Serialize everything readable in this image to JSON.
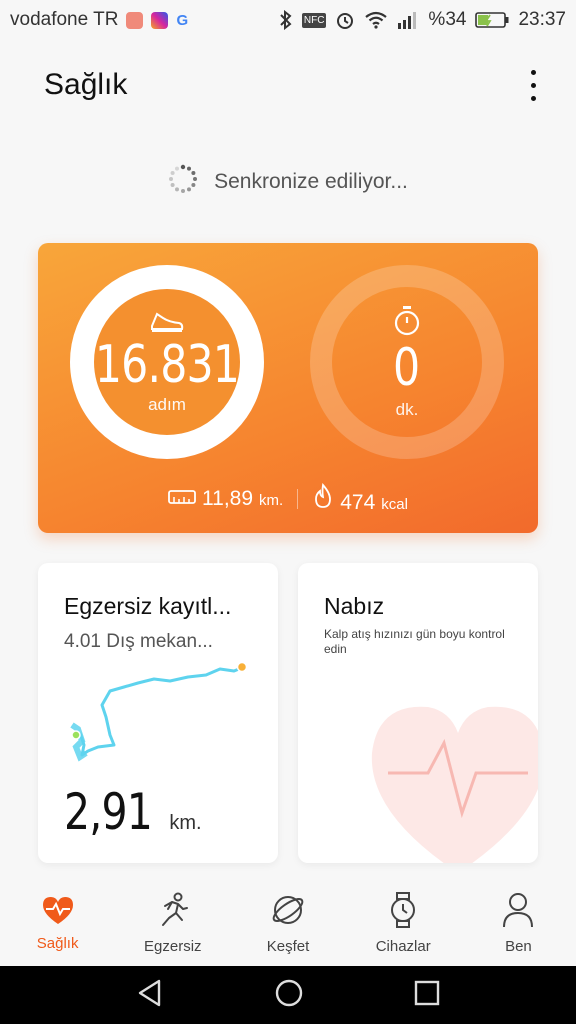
{
  "status_bar": {
    "carrier": "vodafone TR",
    "battery": "%34",
    "time": "23:37",
    "nfc_label": "NFC",
    "app_icons": [
      "mail-app-icon",
      "instagram-icon",
      "google-icon"
    ],
    "system_icons": [
      "bluetooth-icon",
      "nfc-icon",
      "alarm-icon",
      "wifi-icon",
      "signal-icon",
      "battery-icon"
    ]
  },
  "header": {
    "title": "Sağlık"
  },
  "sync": {
    "label": "Senkronize ediliyor..."
  },
  "activity": {
    "steps": "16.831",
    "steps_unit": "adım",
    "steps_progress": 0.9,
    "minutes": "0",
    "minutes_unit": "dk.",
    "distance": "11,89",
    "distance_unit": "km.",
    "calories": "474",
    "calories_unit": "kcal"
  },
  "exercise_card": {
    "title": "Egzersiz kayıtl...",
    "subtitle": "4.01 Dış mekan...",
    "distance": "2,91",
    "distance_unit": "km."
  },
  "pulse_card": {
    "title": "Nabız",
    "description": "Kalp atış hızınızı gün boyu kontrol edin"
  },
  "bottom_nav": [
    {
      "label": "Sağlık",
      "icon": "health-heart-icon",
      "active": true
    },
    {
      "label": "Egzersiz",
      "icon": "runner-icon",
      "active": false
    },
    {
      "label": "Keşfet",
      "icon": "planet-icon",
      "active": false
    },
    {
      "label": "Cihazlar",
      "icon": "watch-icon",
      "active": false
    },
    {
      "label": "Ben",
      "icon": "person-icon",
      "active": false
    }
  ],
  "colors": {
    "accent": "#f05a1a",
    "card_orange": "#f6842f",
    "route_line": "#5ed3ee"
  }
}
